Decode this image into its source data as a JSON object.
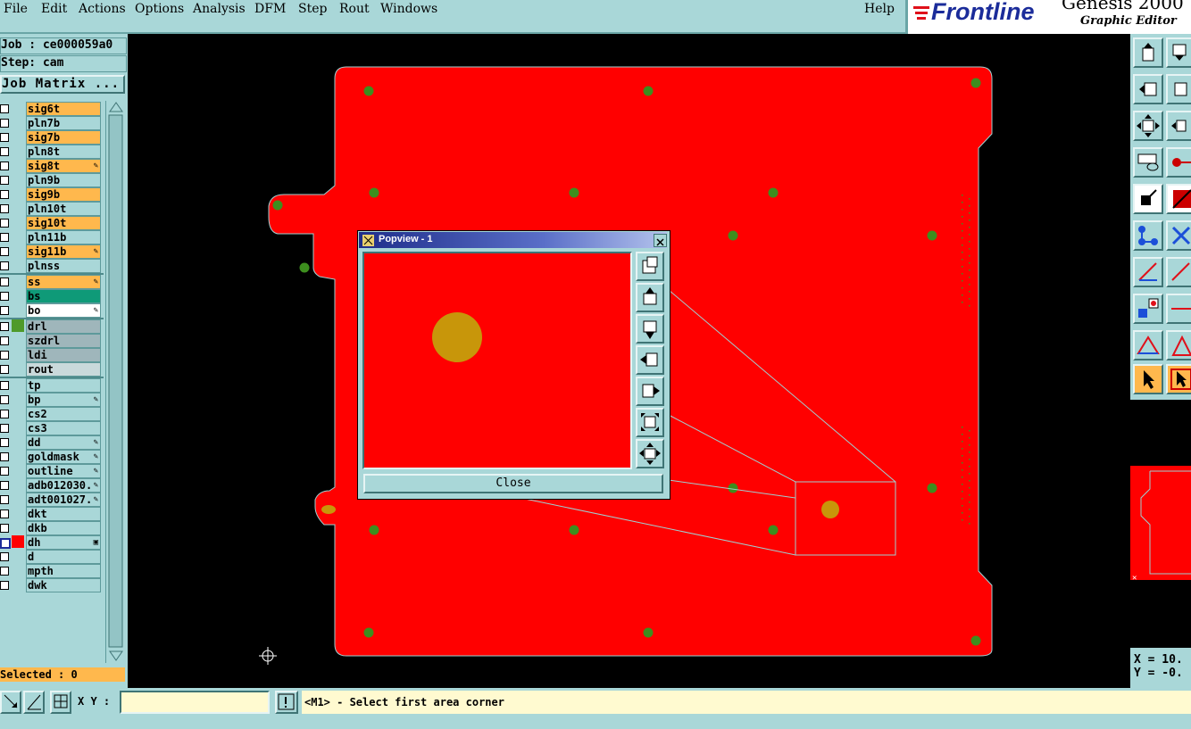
{
  "menu": [
    "File",
    "Edit",
    "Actions",
    "Options",
    "Analysis",
    "DFM",
    "Step",
    "Rout",
    "Windows"
  ],
  "help": "Help",
  "brand": {
    "name": "Frontline",
    "product": "Genesis 2000",
    "subtitle": "Graphic Editor"
  },
  "job": {
    "job": "Job : ce000059a0",
    "step": "Step: cam",
    "matrix": "Job Matrix ..."
  },
  "layers": [
    {
      "name": "sig6t",
      "color": "#ffb84d",
      "flag": "",
      "sw": ""
    },
    {
      "name": "pln7b",
      "color": "#a9d7d8",
      "flag": "",
      "sw": ""
    },
    {
      "name": "sig7b",
      "color": "#ffb84d",
      "flag": "",
      "sw": ""
    },
    {
      "name": "pln8t",
      "color": "#a9d7d8",
      "flag": "",
      "sw": ""
    },
    {
      "name": "sig8t",
      "color": "#ffb84d",
      "flag": "✎",
      "sw": ""
    },
    {
      "name": "pln9b",
      "color": "#a9d7d8",
      "flag": "",
      "sw": ""
    },
    {
      "name": "sig9b",
      "color": "#ffb84d",
      "flag": "",
      "sw": ""
    },
    {
      "name": "pln10t",
      "color": "#a9d7d8",
      "flag": "",
      "sw": ""
    },
    {
      "name": "sig10t",
      "color": "#ffb84d",
      "flag": "",
      "sw": ""
    },
    {
      "name": "pln11b",
      "color": "#a9d7d8",
      "flag": "",
      "sw": ""
    },
    {
      "name": "sig11b",
      "color": "#ffb84d",
      "flag": "✎",
      "sw": ""
    },
    {
      "name": "plnss",
      "color": "#a9d7d8",
      "flag": "",
      "sw": ""
    },
    {
      "name": "ss",
      "color": "#ffb84d",
      "flag": "✎",
      "sw": "",
      "sep": true
    },
    {
      "name": "bs",
      "color": "#0f9a78",
      "flag": "",
      "sw": ""
    },
    {
      "name": "bo",
      "color": "#ffffff",
      "flag": "✎",
      "sw": ""
    },
    {
      "name": "drl",
      "color": "#9fb6bb",
      "flag": "",
      "sw": "#4f9a2a",
      "sep": true
    },
    {
      "name": "szdrl",
      "color": "#9fb6bb",
      "flag": "",
      "sw": ""
    },
    {
      "name": "ldi",
      "color": "#9fb6bb",
      "flag": "",
      "sw": ""
    },
    {
      "name": "rout",
      "color": "#c9d9db",
      "flag": "",
      "sw": ""
    },
    {
      "name": "tp",
      "color": "#a9d7d8",
      "flag": "",
      "sw": "",
      "sep": true
    },
    {
      "name": "bp",
      "color": "#a9d7d8",
      "flag": "✎",
      "sw": ""
    },
    {
      "name": "cs2",
      "color": "#a9d7d8",
      "flag": "",
      "sw": ""
    },
    {
      "name": "cs3",
      "color": "#a9d7d8",
      "flag": "",
      "sw": ""
    },
    {
      "name": "dd",
      "color": "#a9d7d8",
      "flag": "✎",
      "sw": ""
    },
    {
      "name": "goldmask",
      "color": "#a9d7d8",
      "flag": "✎",
      "sw": ""
    },
    {
      "name": "outline",
      "color": "#a9d7d8",
      "flag": "✎",
      "sw": ""
    },
    {
      "name": "adb012030.",
      "color": "#a9d7d8",
      "flag": "✎",
      "sw": ""
    },
    {
      "name": "adt001027.",
      "color": "#a9d7d8",
      "flag": "✎",
      "sw": ""
    },
    {
      "name": "dkt",
      "color": "#a9d7d8",
      "flag": "",
      "sw": ""
    },
    {
      "name": "dkb",
      "color": "#a9d7d8",
      "flag": "",
      "sw": ""
    },
    {
      "name": "dh",
      "color": "#a9d7d8",
      "flag": "▣",
      "sw": "#ff0000",
      "active": true
    },
    {
      "name": "d",
      "color": "#a9d7d8",
      "flag": "",
      "sw": ""
    },
    {
      "name": "mpth",
      "color": "#a9d7d8",
      "flag": "",
      "sw": ""
    },
    {
      "name": "dwk",
      "color": "#a9d7d8",
      "flag": "",
      "sw": ""
    }
  ],
  "selected": "Selected : 0",
  "popview": {
    "title": "Popview - 1",
    "close": "Close"
  },
  "coords": {
    "x": "X = 10.",
    "y": "Y = -0."
  },
  "bottom": {
    "xy_label": "X Y :",
    "input_value": "",
    "prompt": "<M1> - Select first area corner"
  },
  "colors": {
    "panel": "#a9d7d8",
    "board": "#ff0000",
    "pad": "#3d8e1e",
    "gold": "#c8960a"
  }
}
